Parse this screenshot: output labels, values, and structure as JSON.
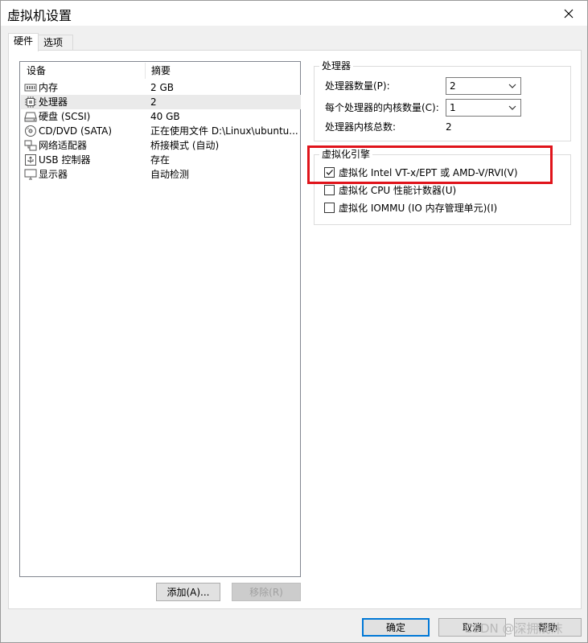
{
  "window": {
    "title": "虚拟机设置",
    "close_icon": "close-icon"
  },
  "tabs": [
    {
      "label": "硬件",
      "active": true
    },
    {
      "label": "选项",
      "active": false
    }
  ],
  "device_list": {
    "columns": [
      "设备",
      "摘要"
    ],
    "rows": [
      {
        "icon": "memory-icon",
        "name": "内存",
        "summary": "2 GB",
        "selected": false
      },
      {
        "icon": "processor-icon",
        "name": "处理器",
        "summary": "2",
        "selected": true
      },
      {
        "icon": "hard-disk-icon",
        "name": "硬盘 (SCSI)",
        "summary": "40 GB",
        "selected": false
      },
      {
        "icon": "cd-dvd-icon",
        "name": "CD/DVD (SATA)",
        "summary": "正在使用文件 D:\\Linux\\ubuntu...",
        "selected": false
      },
      {
        "icon": "network-adapter-icon",
        "name": "网络适配器",
        "summary": "桥接模式 (自动)",
        "selected": false
      },
      {
        "icon": "usb-icon",
        "name": "USB 控制器",
        "summary": "存在",
        "selected": false
      },
      {
        "icon": "display-icon",
        "name": "显示器",
        "summary": "自动检测",
        "selected": false
      }
    ]
  },
  "list_buttons": {
    "add": "添加(A)...",
    "remove": "移除(R)"
  },
  "processor_group": {
    "title": "处理器",
    "processor_count_label": "处理器数量(P):",
    "processor_count_value": "2",
    "cores_per_processor_label": "每个处理器的内核数量(C):",
    "cores_per_processor_value": "1",
    "total_cores_label": "处理器内核总数:",
    "total_cores_value": "2"
  },
  "virtualization_group": {
    "title": "虚拟化引擎",
    "options": [
      {
        "label": "虚拟化 Intel VT-x/EPT 或 AMD-V/RVI(V)",
        "checked": true
      },
      {
        "label": "虚拟化 CPU 性能计数器(U)",
        "checked": false
      },
      {
        "label": "虚拟化 IOMMU (IO 内存管理单元)(I)",
        "checked": false
      }
    ]
  },
  "dialog_buttons": {
    "ok": "确定",
    "cancel": "取消",
    "help": "帮助"
  },
  "watermark": "CSDN @深拥浅沫",
  "colors": {
    "highlight_border": "#e0141b",
    "default_button_border": "#0078d7",
    "selected_row": "#eaeaea"
  }
}
